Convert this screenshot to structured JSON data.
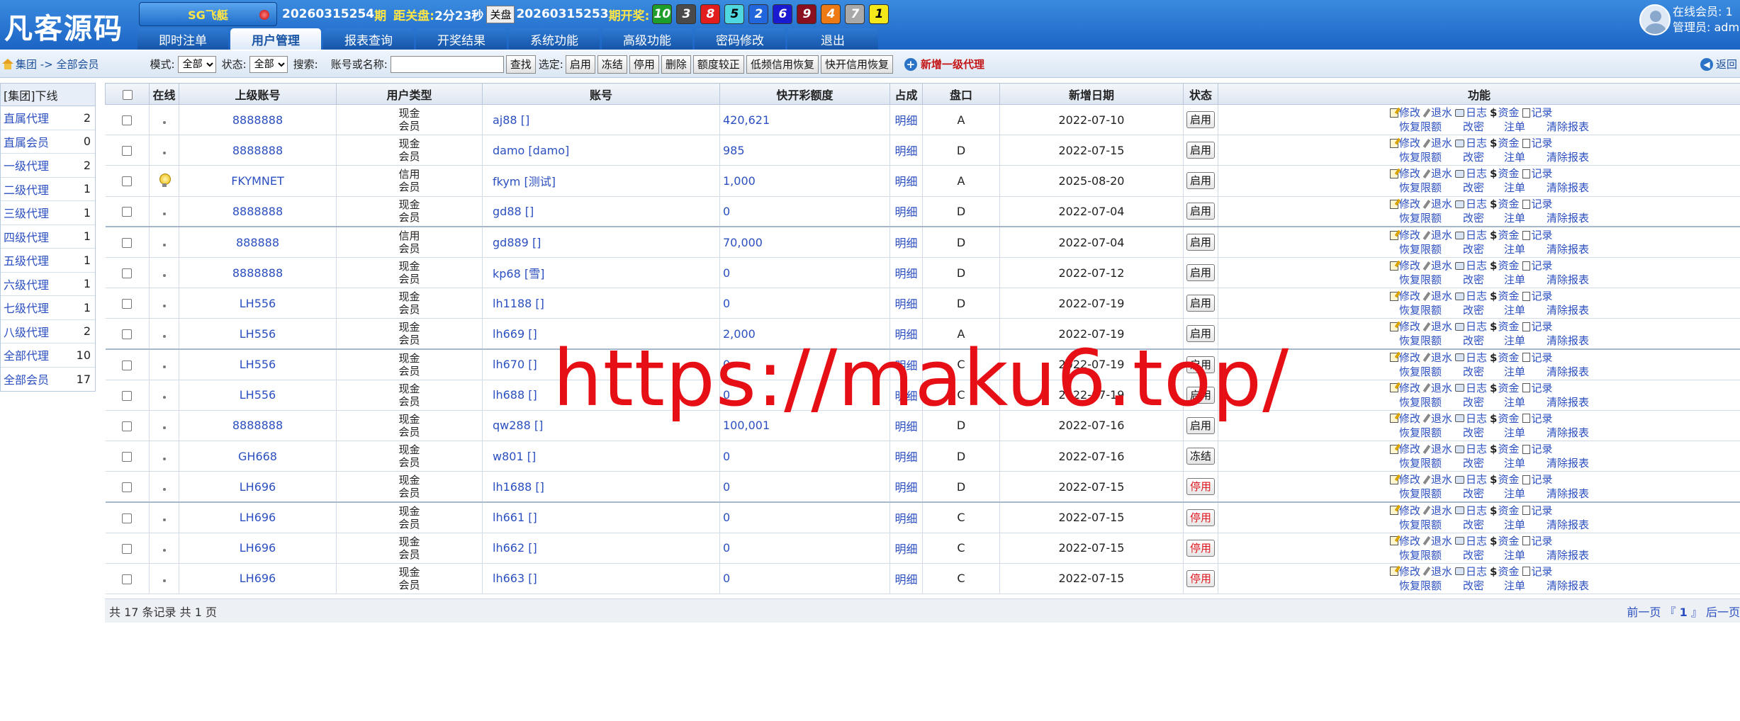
{
  "header": {
    "logo": "凡客源码",
    "game_button": "SG飞艇",
    "current_period": "20260315254",
    "period_suffix": "期",
    "countdown_label": "距关盘:",
    "countdown": "2分23秒",
    "close_button": "关盘",
    "last_period": "20260315253",
    "last_period_label": "期开奖:",
    "balls": [
      {
        "num": "10",
        "color": "#1f9d2a"
      },
      {
        "num": "3",
        "color": "#4a4a4a"
      },
      {
        "num": "8",
        "color": "#e21d1d"
      },
      {
        "num": "5",
        "color": "#4fd8e0"
      },
      {
        "num": "2",
        "color": "#2266dd"
      },
      {
        "num": "6",
        "color": "#1a1ad0"
      },
      {
        "num": "9",
        "color": "#8a0f1f"
      },
      {
        "num": "4",
        "color": "#ee7a16"
      },
      {
        "num": "7",
        "color": "#a9a9a9"
      },
      {
        "num": "1",
        "color": "#f5e81a"
      }
    ],
    "online_label": "在线会员: 1",
    "admin_label": "管理员: adm"
  },
  "nav": [
    "即时注单",
    "用户管理",
    "报表查询",
    "开奖结果",
    "系统功能",
    "高级功能",
    "密码修改",
    "退出"
  ],
  "toolbar": {
    "breadcrumb": "集团 -> 全部会员",
    "mode_label": "模式:",
    "mode_value": "全部",
    "status_label": "状态:",
    "status_value": "全部",
    "search_label": "搜索:",
    "search_field_label": "账号或名称:",
    "find_button": "查找",
    "select_label": "选定:",
    "buttons": [
      "启用",
      "冻结",
      "停用",
      "删除",
      "额度较正",
      "低频信用恢复",
      "快开信用恢复"
    ],
    "add_agent": "新增一级代理",
    "back": "返回"
  },
  "sidebar": {
    "title": "[集团]下线",
    "items": [
      {
        "label": "直属代理",
        "count": "2"
      },
      {
        "label": "直属会员",
        "count": "0"
      },
      {
        "label": "一级代理",
        "count": "2"
      },
      {
        "label": "二级代理",
        "count": "1"
      },
      {
        "label": "三级代理",
        "count": "1"
      },
      {
        "label": "四级代理",
        "count": "1"
      },
      {
        "label": "五级代理",
        "count": "1"
      },
      {
        "label": "六级代理",
        "count": "1"
      },
      {
        "label": "七级代理",
        "count": "1"
      },
      {
        "label": "八级代理",
        "count": "2"
      },
      {
        "label": "全部代理",
        "count": "10"
      },
      {
        "label": "全部会员",
        "count": "17"
      }
    ]
  },
  "table": {
    "headers": [
      "",
      "在线",
      "上级账号",
      "用户类型",
      "账号",
      "快开彩额度",
      "占成",
      "盘口",
      "新增日期",
      "状态",
      "功能"
    ],
    "rows": [
      {
        "parent": "8888888",
        "type1": "现金",
        "type2": "会员",
        "account": "aj88 []",
        "credit": "420,621",
        "share": "明细",
        "plate": "A",
        "date": "2022-07-10",
        "status": "启用",
        "red": false,
        "bulb": false
      },
      {
        "parent": "8888888",
        "type1": "现金",
        "type2": "会员",
        "account": "damo [damo]",
        "credit": "985",
        "share": "明细",
        "plate": "D",
        "date": "2022-07-15",
        "status": "启用",
        "red": false,
        "bulb": false
      },
      {
        "parent": "FKYMNET",
        "type1": "信用",
        "type2": "会员",
        "account": "fkym [测试]",
        "credit": "1,000",
        "share": "明细",
        "plate": "A",
        "date": "2025-08-20",
        "status": "启用",
        "red": false,
        "bulb": true
      },
      {
        "parent": "8888888",
        "type1": "现金",
        "type2": "会员",
        "account": "gd88 []",
        "credit": "0",
        "share": "明细",
        "plate": "D",
        "date": "2022-07-04",
        "status": "启用",
        "red": false,
        "bulb": false
      },
      {
        "parent": "888888",
        "type1": "信用",
        "type2": "会员",
        "account": "gd889 []",
        "credit": "70,000",
        "share": "明细",
        "plate": "D",
        "date": "2022-07-04",
        "status": "启用",
        "red": false,
        "bulb": false
      },
      {
        "parent": "8888888",
        "type1": "现金",
        "type2": "会员",
        "account": "kp68 [雪]",
        "credit": "0",
        "share": "明细",
        "plate": "D",
        "date": "2022-07-12",
        "status": "启用",
        "red": false,
        "bulb": false
      },
      {
        "parent": "LH556",
        "type1": "现金",
        "type2": "会员",
        "account": "lh1188 []",
        "credit": "0",
        "share": "明细",
        "plate": "D",
        "date": "2022-07-19",
        "status": "启用",
        "red": false,
        "bulb": false
      },
      {
        "parent": "LH556",
        "type1": "现金",
        "type2": "会员",
        "account": "lh669 []",
        "credit": "2,000",
        "share": "明细",
        "plate": "A",
        "date": "2022-07-19",
        "status": "启用",
        "red": false,
        "bulb": false
      },
      {
        "parent": "LH556",
        "type1": "现金",
        "type2": "会员",
        "account": "lh670 []",
        "credit": "0",
        "share": "明细",
        "plate": "C",
        "date": "2022-07-19",
        "status": "启用",
        "red": false,
        "bulb": false
      },
      {
        "parent": "LH556",
        "type1": "现金",
        "type2": "会员",
        "account": "lh688 []",
        "credit": "0",
        "share": "明细",
        "plate": "C",
        "date": "2022-07-19",
        "status": "启用",
        "red": false,
        "bulb": false
      },
      {
        "parent": "8888888",
        "type1": "现金",
        "type2": "会员",
        "account": "qw288 []",
        "credit": "100,001",
        "share": "明细",
        "plate": "D",
        "date": "2022-07-16",
        "status": "启用",
        "red": false,
        "bulb": false
      },
      {
        "parent": "GH668",
        "type1": "现金",
        "type2": "会员",
        "account": "w801 []",
        "credit": "0",
        "share": "明细",
        "plate": "D",
        "date": "2022-07-16",
        "status": "冻结",
        "red": false,
        "bulb": false
      },
      {
        "parent": "LH696",
        "type1": "现金",
        "type2": "会员",
        "account": "lh1688 []",
        "credit": "0",
        "share": "明细",
        "plate": "D",
        "date": "2022-07-15",
        "status": "停用",
        "red": true,
        "bulb": false
      },
      {
        "parent": "LH696",
        "type1": "现金",
        "type2": "会员",
        "account": "lh661 []",
        "credit": "0",
        "share": "明细",
        "plate": "C",
        "date": "2022-07-15",
        "status": "停用",
        "red": true,
        "bulb": false
      },
      {
        "parent": "LH696",
        "type1": "现金",
        "type2": "会员",
        "account": "lh662 []",
        "credit": "0",
        "share": "明细",
        "plate": "C",
        "date": "2022-07-15",
        "status": "停用",
        "red": true,
        "bulb": false
      },
      {
        "parent": "LH696",
        "type1": "现金",
        "type2": "会员",
        "account": "lh663 []",
        "credit": "0",
        "share": "明细",
        "plate": "C",
        "date": "2022-07-15",
        "status": "停用",
        "red": true,
        "bulb": false
      }
    ],
    "func_line1": [
      "修改",
      "退水",
      "日志",
      "资金",
      "记录"
    ],
    "func_line2": [
      "恢复限额",
      "改密",
      "注单",
      "清除报表"
    ]
  },
  "footer": {
    "summary": "共 17 条记录 共 1 页",
    "prev": "前一页",
    "bracket_open": "『",
    "page": "1",
    "bracket_close": "』",
    "next": "后一页"
  },
  "watermark": "https://maku6.top/"
}
